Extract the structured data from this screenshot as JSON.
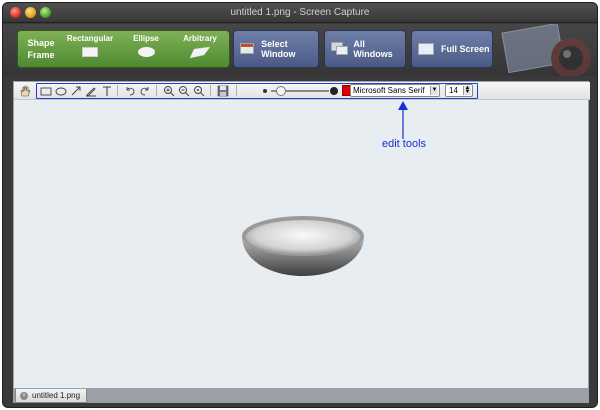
{
  "window": {
    "title": "untitled 1.png - Screen Capture"
  },
  "toolbar": {
    "shape_frame_label": "Shape Frame",
    "shape_buttons": [
      {
        "label": "Rectangular",
        "icon": "rectangle-icon"
      },
      {
        "label": "Ellipse",
        "icon": "ellipse-icon"
      },
      {
        "label": "Arbitrary",
        "icon": "arbitrary-shape-icon"
      }
    ],
    "select_window_label": "Select Window",
    "all_windows_label": "All Windows",
    "full_screen_label": "Full Screen"
  },
  "edit_tools": {
    "tools": [
      "hand-icon",
      "rectangle-tool-icon",
      "ellipse-tool-icon",
      "arrow-tool-icon",
      "pen-tool-icon",
      "text-tool-icon",
      "undo-icon",
      "redo-icon",
      "zoom-in-icon",
      "zoom-out-icon",
      "zoom-fit-icon",
      "save-icon"
    ],
    "stroke_color": "#e00000",
    "font_name": "Microsoft Sans Serif",
    "font_size": "14"
  },
  "annotation": {
    "label": "edit tools",
    "color": "#1a2fd0"
  },
  "tabs": [
    {
      "label": "untitled 1.png"
    }
  ]
}
